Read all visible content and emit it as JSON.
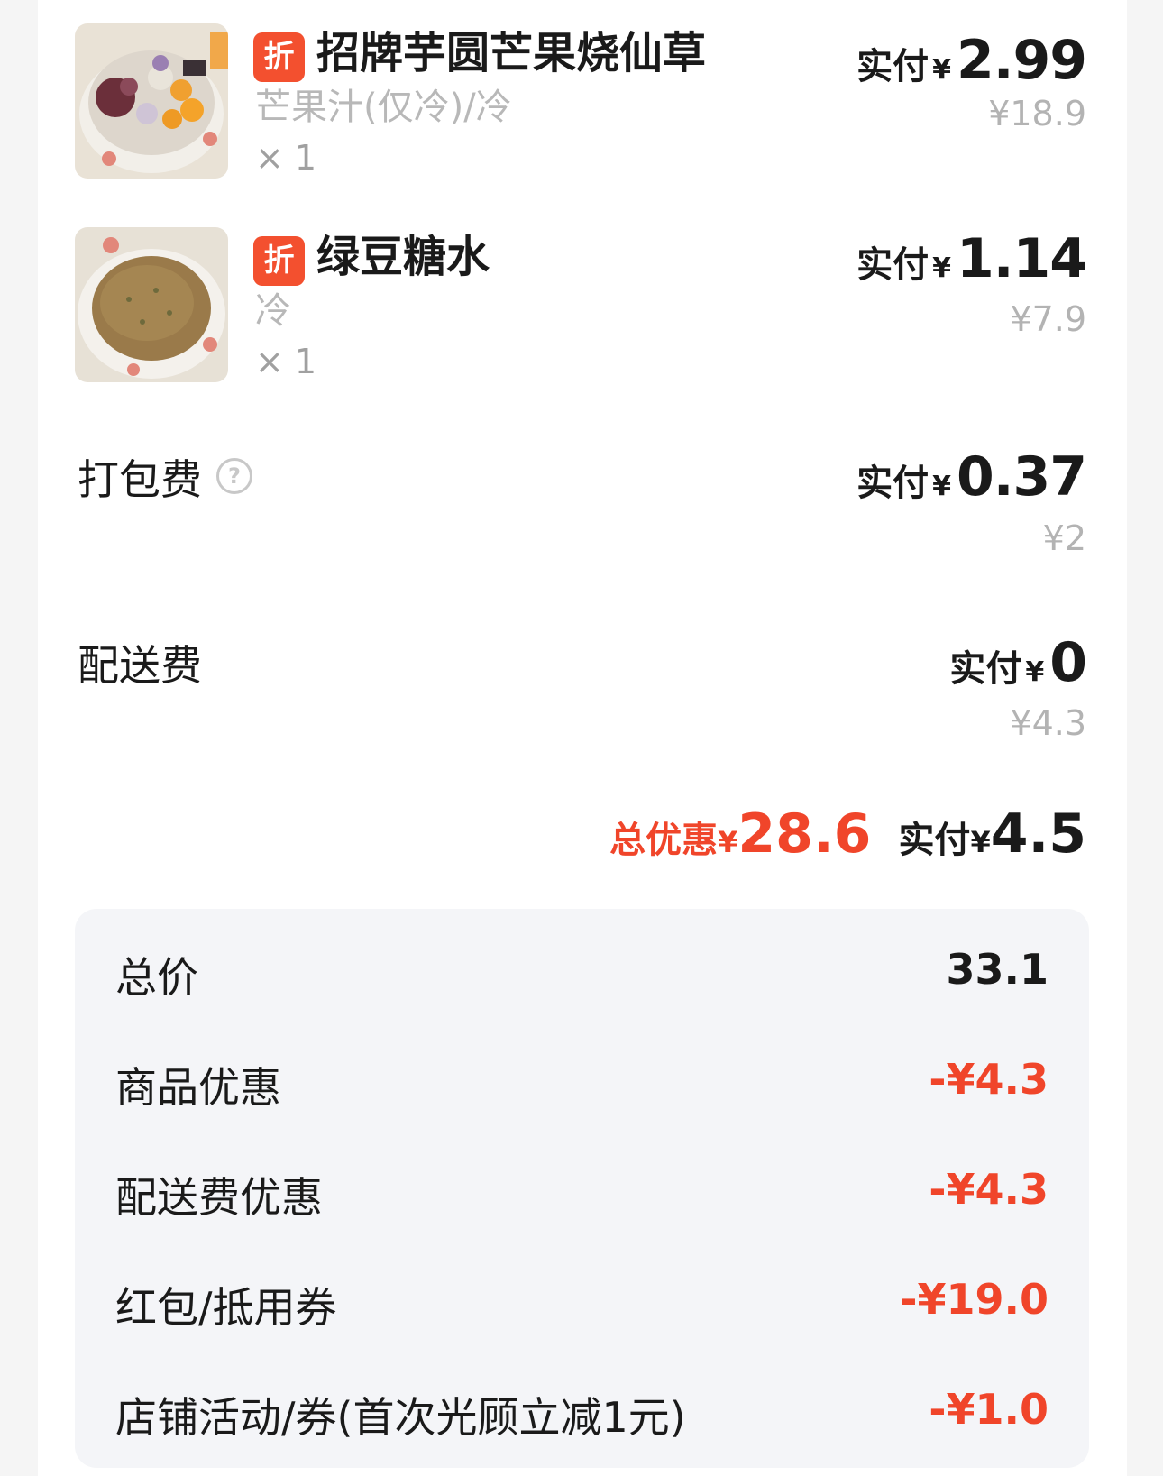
{
  "items": [
    {
      "badge": "折",
      "name": "招牌芋圆芒果烧仙草",
      "spec": "芒果汁(仅冷)/冷",
      "qty": "× 1",
      "pay_label": "实付",
      "currency": "¥",
      "pay_value": "2.99",
      "original_price": "¥18.9"
    },
    {
      "badge": "折",
      "name": "绿豆糖水",
      "spec": "冷",
      "qty": "× 1",
      "pay_label": "实付",
      "currency": "¥",
      "pay_value": "1.14",
      "original_price": "¥7.9"
    }
  ],
  "packing_fee": {
    "label": "打包费",
    "help_icon": "question-circle-icon",
    "help_glyph": "?",
    "pay_label": "实付",
    "currency": "¥",
    "pay_value": "0.37",
    "original_price": "¥2"
  },
  "delivery_fee": {
    "label": "配送费",
    "pay_label": "实付",
    "currency": "¥",
    "pay_value": "0",
    "original_price": "¥4.3"
  },
  "summary": {
    "discount_label": "总优惠",
    "currency": "¥",
    "discount_value": "28.6",
    "pay_label": "实付",
    "pay_value": "4.5"
  },
  "breakdown": [
    {
      "label": "总价",
      "value": "33.1"
    },
    {
      "label": "商品优惠",
      "value": "-¥4.3"
    },
    {
      "label": "配送费优惠",
      "value": "-¥4.3"
    },
    {
      "label": "红包/抵用券",
      "value": "-¥19.0"
    },
    {
      "label": "店铺活动/券(首次光顾立减1元)",
      "value": "-¥1.0"
    }
  ],
  "colors": {
    "accent_red": "#f0452a",
    "badge_red": "#f3502f",
    "muted_gray": "#b3b3b3",
    "panel_bg": "#f4f5f8"
  }
}
